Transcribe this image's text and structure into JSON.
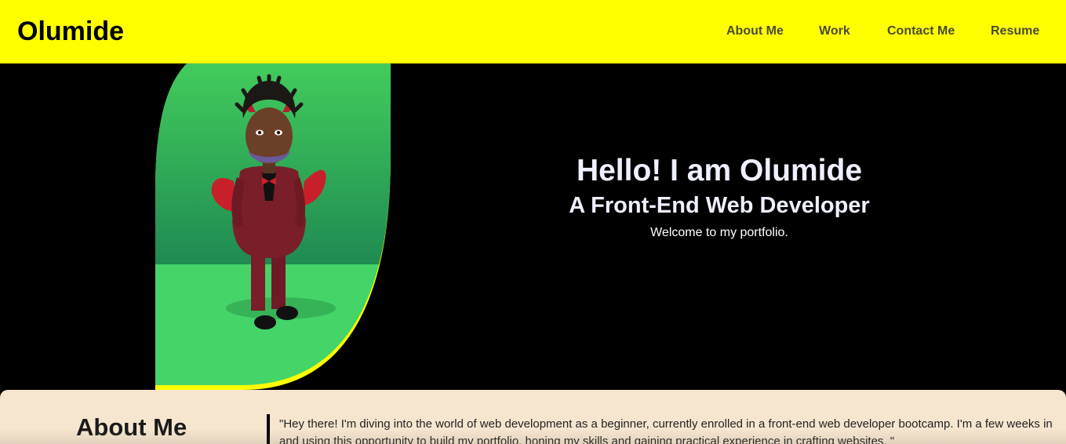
{
  "header": {
    "brand": "Olumide",
    "nav": [
      "About Me",
      "Work",
      "Contact Me",
      "Resume"
    ]
  },
  "hero": {
    "title": "Hello! I am Olumide",
    "subtitle": "A Front-End Web Developer",
    "welcome": "Welcome to my portfolio."
  },
  "about": {
    "heading": "About Me",
    "text": "\"Hey there! I'm diving into the world of web development as a beginner, currently enrolled in a front-end web developer bootcamp. I'm a few weeks in and using this opportunity to build my portfolio, honing my skills and gaining practical experience in crafting websites. \""
  },
  "colors": {
    "header_bg": "#ffff00",
    "hero_bg": "#000000",
    "avatar_bg": "#44d468",
    "avatar_border": "#ffff00",
    "about_bg": "#f6e6d0"
  }
}
